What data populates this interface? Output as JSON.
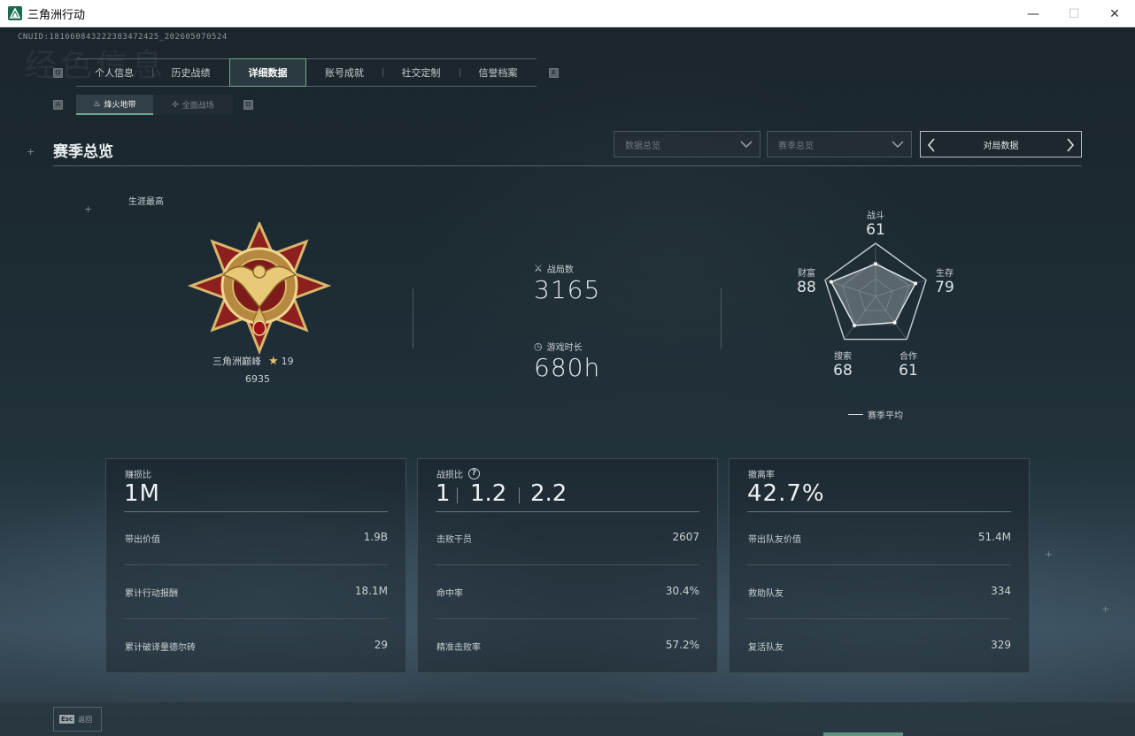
{
  "window": {
    "title": "三角洲行动",
    "controls": {
      "minimize": "—",
      "maximize": "☐",
      "close": "✕"
    }
  },
  "uid": "CNUID:1816608432223834724​25_202605070524",
  "background_text": "经色信息",
  "main_tabs": [
    {
      "label": "个人信息",
      "active": false
    },
    {
      "label": "历史战绩",
      "active": false
    },
    {
      "label": "详细数据",
      "active": true
    },
    {
      "label": "账号成就",
      "active": false
    },
    {
      "label": "社交定制",
      "active": false
    },
    {
      "label": "信誉档案",
      "active": false
    }
  ],
  "key_hints": {
    "left": "Q",
    "right": "E",
    "sub_left": "A",
    "sub_right": "D"
  },
  "sub_tabs": [
    {
      "label": "烽火地带",
      "icon": "fire-zone-icon",
      "active": true
    },
    {
      "label": "全面战场",
      "icon": "battlefield-icon",
      "active": false
    }
  ],
  "section": {
    "title": "赛季总览"
  },
  "filters": {
    "data_overview": "数据总览",
    "season_overview": "赛季总览",
    "match_data": "对局数据"
  },
  "career": {
    "label": "生涯最高",
    "rank_name": "三角洲巅峰",
    "stars": "19",
    "score": "6935"
  },
  "stats": {
    "matches_label": "战局数",
    "matches_value": "3165",
    "playtime_label": "游戏时长",
    "playtime_value": "680h"
  },
  "radar": {
    "axes": [
      {
        "label": "战斗",
        "value": 61
      },
      {
        "label": "生存",
        "value": 79
      },
      {
        "label": "合作",
        "value": 61
      },
      {
        "label": "搜索",
        "value": 68
      },
      {
        "label": "财富",
        "value": 88
      }
    ],
    "legend": "赛季平均"
  },
  "cards": {
    "profit": {
      "title": "赚损比",
      "big": "1M",
      "rows": [
        {
          "label": "带出价值",
          "value": "1.9B"
        },
        {
          "label": "累计行动报酬",
          "value": "18.1M"
        },
        {
          "label": "累计破译量德尔砖",
          "value": "29"
        }
      ]
    },
    "kd": {
      "title": "战损比",
      "help": "?",
      "values": [
        "1",
        "1.2",
        "2.2"
      ],
      "rows": [
        {
          "label": "击败干员",
          "value": "2607"
        },
        {
          "label": "命中率",
          "value": "30.4%"
        },
        {
          "label": "精准击败率",
          "value": "57.2%"
        }
      ]
    },
    "extract": {
      "title": "撤离率",
      "big": "42.7%",
      "rows": [
        {
          "label": "带出队友价值",
          "value": "51.4M"
        },
        {
          "label": "救助队友",
          "value": "334"
        },
        {
          "label": "复活队友",
          "value": "329"
        }
      ]
    }
  },
  "bottom": {
    "esc_key": "Esc",
    "esc_label": "返回"
  },
  "colors": {
    "accent": "#6fa88f",
    "star": "#e2c36e",
    "medal_gold": "#d8b66a",
    "medal_red": "#8e1f1f"
  }
}
